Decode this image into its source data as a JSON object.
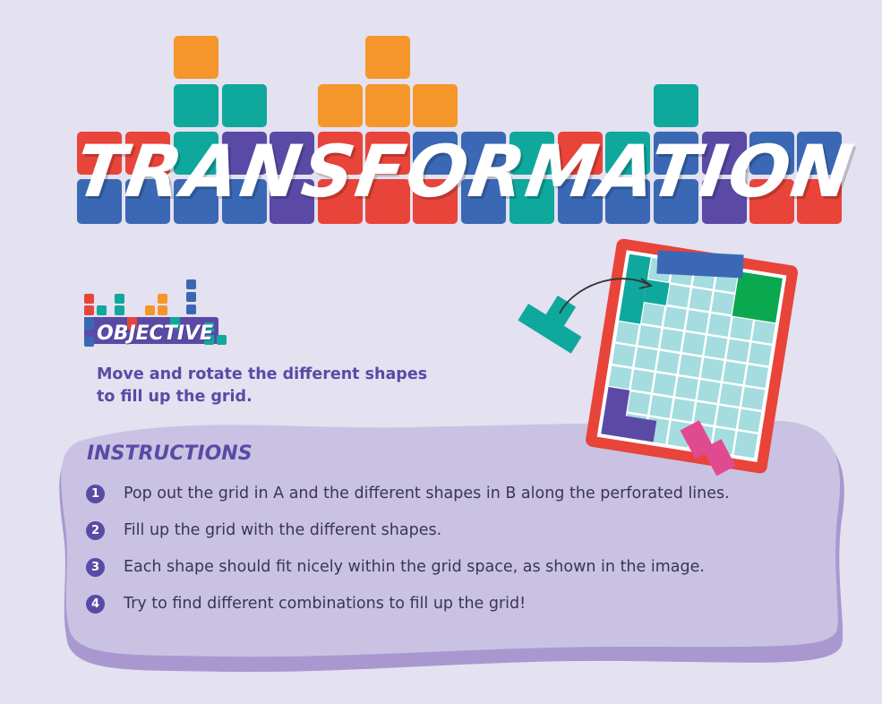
{
  "title": "TRANSFORMATION",
  "objective": {
    "label": "OBJECTIVE",
    "text": "Move and rotate the different shapes to fill up the grid."
  },
  "instructions": {
    "title": "INSTRUCTIONS",
    "steps": [
      {
        "num": "1",
        "text": "Pop out the grid in A and the different shapes in B along the perforated lines."
      },
      {
        "num": "2",
        "text": "Fill up the grid with the different shapes."
      },
      {
        "num": "3",
        "text": "Each shape should fit nicely within the grid space, as shown in the image."
      },
      {
        "num": "4",
        "text": "Try to find different combinations to fill up the grid!"
      }
    ]
  },
  "colors": {
    "background": "#e4e1f0",
    "red": "#e8443a",
    "blue": "#3a68b4",
    "purple": "#5a4aa6",
    "teal": "#0fa89c",
    "orange": "#f5962a",
    "pink": "#e04a8f",
    "green": "#0aa84f"
  }
}
